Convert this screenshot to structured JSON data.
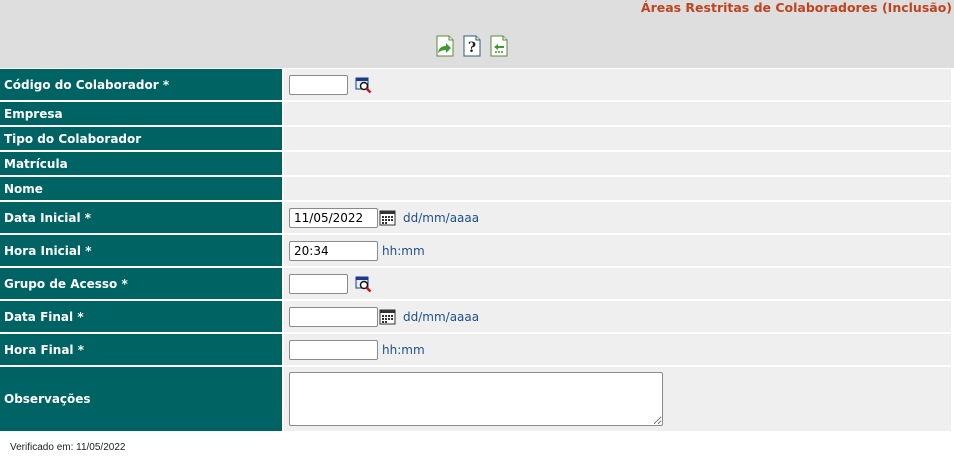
{
  "header": {
    "title": "Áreas Restritas de Colaboradores (Inclusão)",
    "toolbar": [
      {
        "name": "save-icon"
      },
      {
        "name": "help-icon"
      },
      {
        "name": "back-icon"
      }
    ]
  },
  "form": {
    "codigo": {
      "label": "Código do Colaborador *",
      "value": ""
    },
    "empresa": {
      "label": "Empresa"
    },
    "tipo": {
      "label": "Tipo do Colaborador"
    },
    "matricula": {
      "label": "Matrícula"
    },
    "nome": {
      "label": "Nome"
    },
    "data_inicial": {
      "label": "Data Inicial *",
      "value": "11/05/2022",
      "hint": "dd/mm/aaaa"
    },
    "hora_inicial": {
      "label": "Hora Inicial *",
      "value": "20:34",
      "hint": "hh:mm"
    },
    "grupo": {
      "label": "Grupo de Acesso *",
      "value": ""
    },
    "data_final": {
      "label": "Data Final *",
      "value": "",
      "hint": "dd/mm/aaaa"
    },
    "hora_final": {
      "label": "Hora Final *",
      "value": "",
      "hint": "hh:mm"
    },
    "observacoes": {
      "label": "Observações",
      "value": ""
    }
  },
  "footer": {
    "verified": "Verificado em: 11/05/2022"
  },
  "colors": {
    "label_bg": "#006363",
    "value_bg": "#efefef",
    "title": "#c0441e",
    "hint": "#1f4f8a"
  }
}
